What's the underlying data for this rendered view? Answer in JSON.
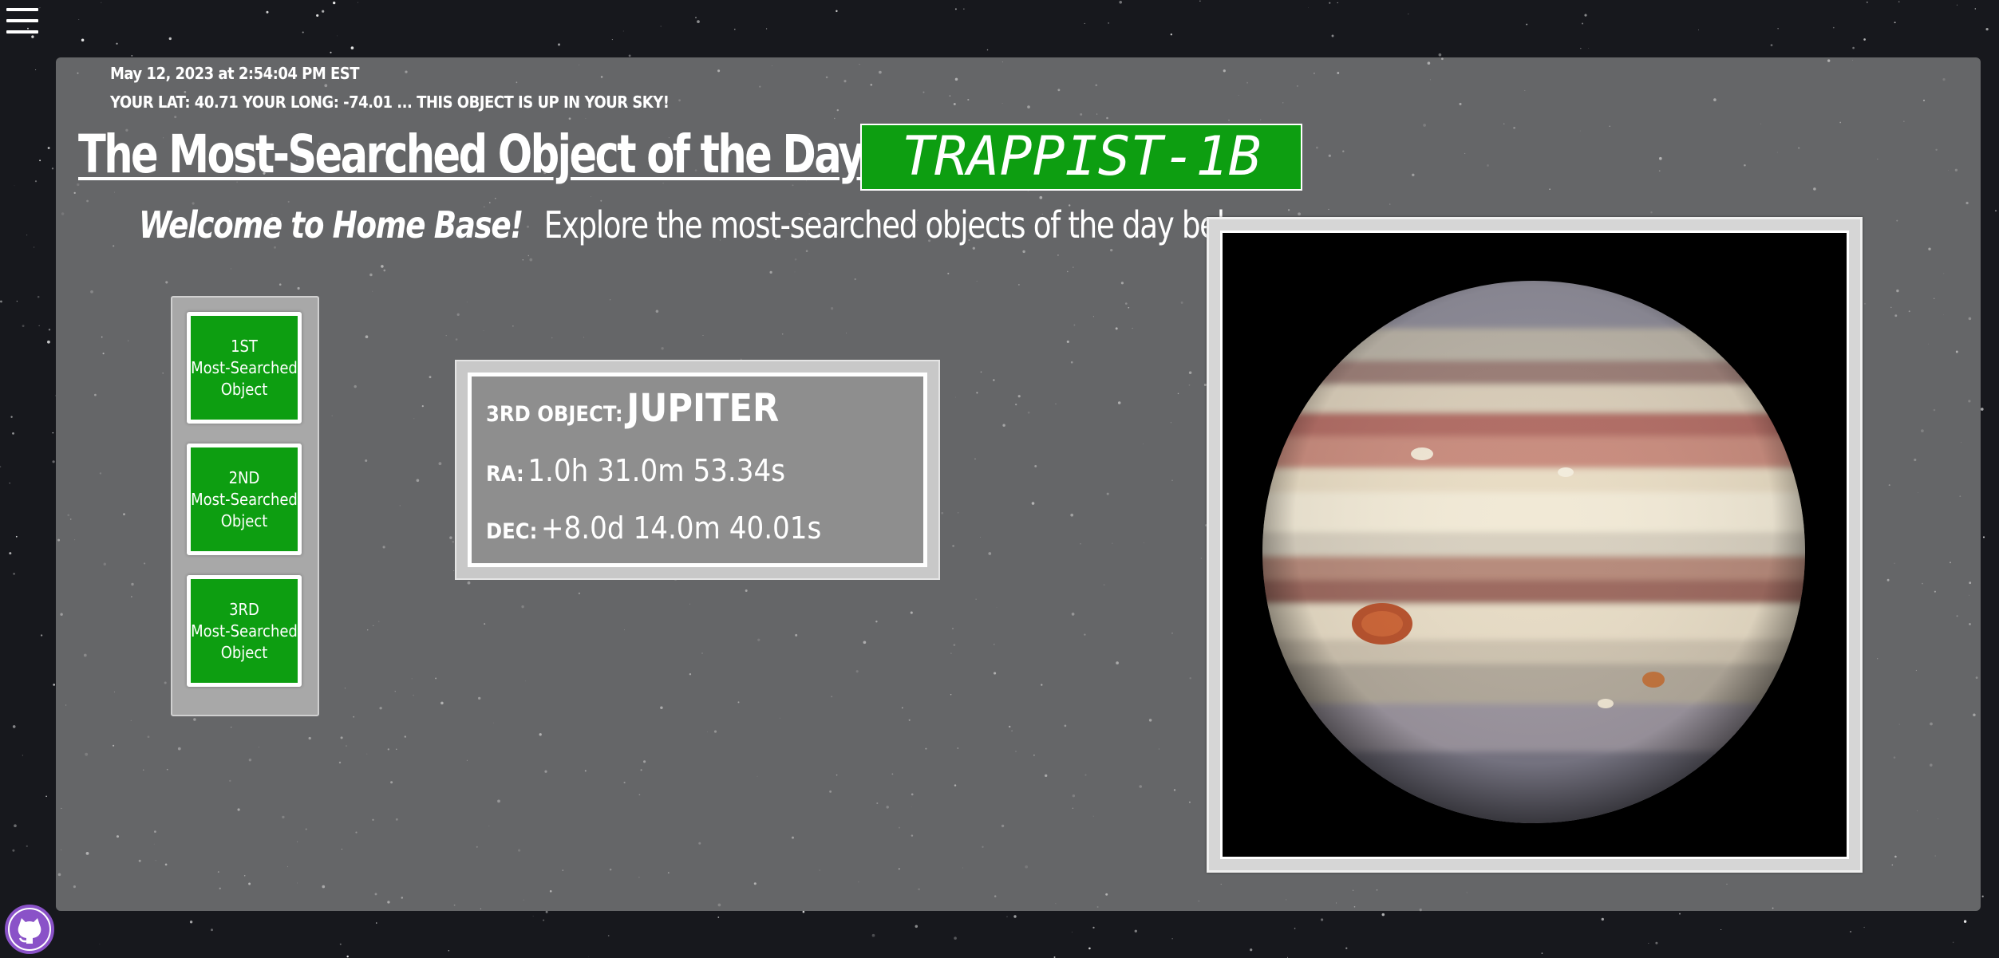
{
  "header": {
    "datetime": "May 12, 2023 at 2:54:04 PM EST",
    "location": "YOUR LAT: 40.71 YOUR LONG: -74.01 ...",
    "visibility": "THIS OBJECT IS UP IN YOUR SKY!",
    "title": "The Most-Searched Object of the Day is:",
    "top_object": "TRAPPIST-1B"
  },
  "welcome": {
    "greeting": "Welcome to Home Base!",
    "subtitle": "Explore the most-searched objects of the day below..."
  },
  "object_buttons": [
    {
      "rank": "1ST",
      "line2": "Most-Searched",
      "line3": "Object"
    },
    {
      "rank": "2ND",
      "line2": "Most-Searched",
      "line3": "Object"
    },
    {
      "rank": "3RD",
      "line2": "Most-Searched",
      "line3": "Object"
    }
  ],
  "selected_object": {
    "object_label": "3RD OBJECT:",
    "name": "JUPITER",
    "ra_label": "RA:",
    "ra_value": "1.0h 31.0m 53.34s",
    "dec_label": "DEC:",
    "dec_value": "+8.0d 14.0m 40.01s"
  },
  "image": {
    "subject": "jupiter"
  },
  "icons": {
    "menu": "hamburger-menu-icon",
    "github": "github-icon"
  },
  "colors": {
    "accent_green": "#0d9e11",
    "panel_gray": "#969696",
    "github_purple": "#8a52c8"
  }
}
